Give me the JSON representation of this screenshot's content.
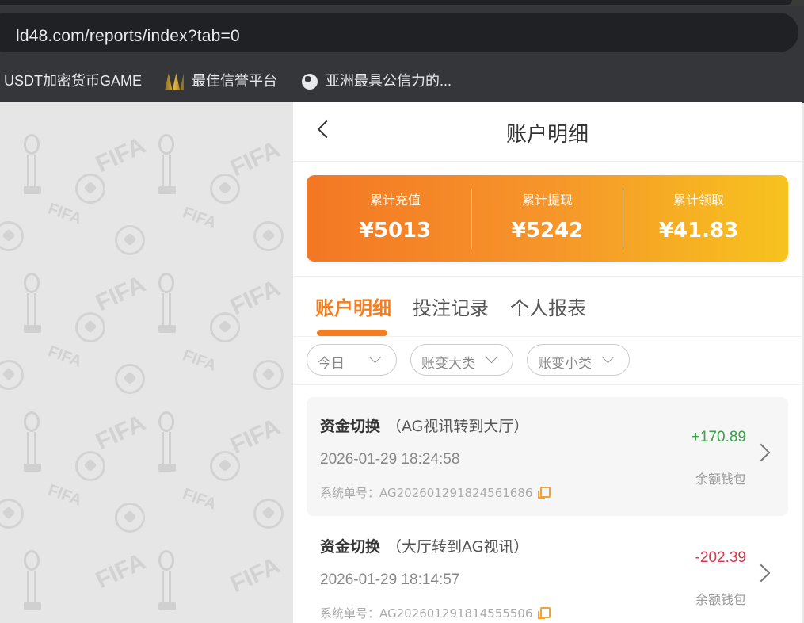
{
  "browser": {
    "url": "ld48.com/reports/index?tab=0",
    "bookmarks": [
      {
        "label": "USDT加密货币GAME",
        "icon": "none"
      },
      {
        "label": "最佳信誉平台",
        "icon": "gold-logo-icon"
      },
      {
        "label": "亚洲最具公信力的...",
        "icon": "globe-icon"
      }
    ]
  },
  "background_pattern": {
    "text": "FIFA"
  },
  "header": {
    "title": "账户明细"
  },
  "summary": [
    {
      "label": "累计充值",
      "value": "¥5013"
    },
    {
      "label": "累计提现",
      "value": "¥5242"
    },
    {
      "label": "累计领取",
      "value": "¥41.83"
    }
  ],
  "tabs": [
    {
      "label": "账户明细",
      "active": true
    },
    {
      "label": "投注记录",
      "active": false
    },
    {
      "label": "个人报表",
      "active": false
    }
  ],
  "filters": [
    {
      "label": "今日"
    },
    {
      "label": "账变大类"
    },
    {
      "label": "账变小类"
    }
  ],
  "records": [
    {
      "type": "资金切换",
      "detail": "（AG视讯转到大厅）",
      "time": "2026-01-29 18:24:58",
      "order_label": "系统单号：",
      "order_no": "AG202601291824561686",
      "amount": "+170.89",
      "wallet": "余额钱包"
    },
    {
      "type": "资金切换",
      "detail": "（大厅转到AG视讯）",
      "time": "2026-01-29 18:14:57",
      "order_label": "系统单号：",
      "order_no": "AG202601291814555506",
      "amount": "-202.39",
      "wallet": "余额钱包"
    }
  ],
  "colors": {
    "accent": "#f47d22",
    "positive": "#3aa24a",
    "negative": "#d8384a"
  }
}
